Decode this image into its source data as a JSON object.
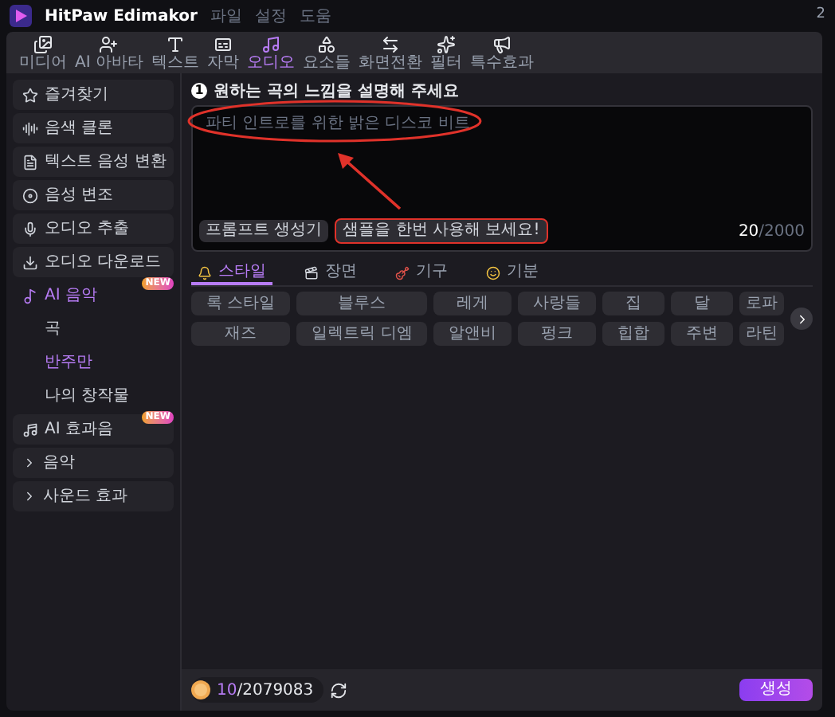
{
  "title_bar": {
    "app_name": "HitPaw Edimakor",
    "menu": [
      "파일",
      "설정",
      "도움"
    ],
    "corner_text": "2"
  },
  "toolbar": [
    {
      "label": "미디어",
      "selected": false
    },
    {
      "label": "AI 아바타",
      "selected": false
    },
    {
      "label": "텍스트",
      "selected": false
    },
    {
      "label": "자막",
      "selected": false
    },
    {
      "label": "오디오",
      "selected": true
    },
    {
      "label": "요소들",
      "selected": false
    },
    {
      "label": "화면전환",
      "selected": false
    },
    {
      "label": "필터",
      "selected": false
    },
    {
      "label": "특수효과",
      "selected": false
    }
  ],
  "sidebar": [
    {
      "label": "즐겨찾기",
      "kind": "item",
      "selected": false
    },
    {
      "label": "음색 클론",
      "kind": "item",
      "selected": false
    },
    {
      "label": "텍스트 음성 변환",
      "kind": "item",
      "selected": false
    },
    {
      "label": "음성 변조",
      "kind": "item",
      "selected": false
    },
    {
      "label": "오디오 추출",
      "kind": "item",
      "selected": false
    },
    {
      "label": "오디오 다운로드",
      "kind": "item",
      "selected": false
    },
    {
      "label": "AI 음악",
      "kind": "group",
      "selected": true,
      "expanded": true,
      "badge": "NEW",
      "children": [
        {
          "label": "곡",
          "selected": false
        },
        {
          "label": "반주만",
          "selected": true
        },
        {
          "label": "나의 창작물",
          "selected": false
        }
      ]
    },
    {
      "label": "AI 효과음",
      "kind": "item",
      "selected": false,
      "badge": "NEW"
    },
    {
      "label": "음악",
      "kind": "folder",
      "selected": false,
      "expanded": false
    },
    {
      "label": "사운드 효과",
      "kind": "folder",
      "selected": false,
      "expanded": false
    }
  ],
  "prompt": {
    "step": "1",
    "heading": "원하는 곡의 느낌을 설명해 주세요",
    "placeholder": "파티 인트로를 위한 밝은 디스코 비트",
    "generator_button": "프롬프트 생성기",
    "sample_button": {
      "label": "샘플을 한번 사용해 보세요!",
      "highlighted": true
    },
    "count": "20",
    "limit": "/2000",
    "highlight_ellipse": true,
    "pointer_arrow": true
  },
  "style_tabs": [
    {
      "label": "스타일",
      "selected": true
    },
    {
      "label": "장면",
      "selected": false
    },
    {
      "label": "기구",
      "selected": false
    },
    {
      "label": "기분",
      "selected": false
    }
  ],
  "chips": [
    [
      "록 스타일",
      "블루스",
      "레게",
      "사랑들",
      "집",
      "달",
      "로파"
    ],
    [
      "재즈",
      "일렉트릭 디엠",
      "알앤비",
      "펑크",
      "힙합",
      "주변",
      "라틴"
    ]
  ],
  "footer": {
    "credits_used": "10",
    "credits_total": "/2079083",
    "generate_button": "생성"
  }
}
